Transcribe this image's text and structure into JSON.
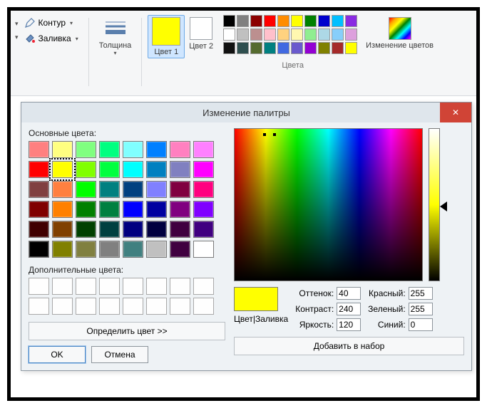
{
  "ribbon": {
    "outline": "Контур",
    "fill": "Заливка",
    "thickness": "Толщина",
    "color1": "Цвет 1",
    "color2": "Цвет 2",
    "color1_value": "#ffff00",
    "color2_value": "#ffffff",
    "palette_row1": [
      "#000000",
      "#808080",
      "#8b0000",
      "#ff0000",
      "#ff8c00",
      "#ffff00",
      "#008000",
      "#0000cd",
      "#00bfff",
      "#8a2be2"
    ],
    "palette_row2": [
      "#ffffff",
      "#c0c0c0",
      "#bc8f8f",
      "#ffc0cb",
      "#ffd27f",
      "#fff8b0",
      "#90ee90",
      "#add8e6",
      "#87cefa",
      "#dda0dd"
    ],
    "palette_row3": [
      "#111111",
      "#2f4f4f",
      "#556b2f",
      "#008080",
      "#4169e1",
      "#6a5acd",
      "#9400d3",
      "#808000",
      "#a52a2a",
      "#ffff00"
    ],
    "edit_colors": "Изменение цветов",
    "group_label": "Цвета"
  },
  "dialog": {
    "title": "Изменение палитры",
    "basic_label": "Основные цвета:",
    "custom_label": "Дополнительные цвета:",
    "basic_rows": [
      [
        "#ff8080",
        "#ffff80",
        "#80ff80",
        "#00ff80",
        "#80ffff",
        "#0080ff",
        "#ff80c0",
        "#ff80ff"
      ],
      [
        "#ff0000",
        "#ffff00",
        "#80ff00",
        "#00ff40",
        "#00ffff",
        "#0080c0",
        "#8080c0",
        "#ff00ff"
      ],
      [
        "#804040",
        "#ff8040",
        "#00ff00",
        "#008080",
        "#004080",
        "#8080ff",
        "#800040",
        "#ff0080"
      ],
      [
        "#800000",
        "#ff8000",
        "#008000",
        "#008040",
        "#0000ff",
        "#0000a0",
        "#800080",
        "#8000ff"
      ],
      [
        "#400000",
        "#804000",
        "#004000",
        "#004040",
        "#000080",
        "#000040",
        "#400040",
        "#400080"
      ],
      [
        "#000000",
        "#808000",
        "#808040",
        "#808080",
        "#408080",
        "#c0c0c0",
        "#400040",
        "#ffffff"
      ]
    ],
    "define_color": "Определить цвет >>",
    "ok": "OK",
    "cancel": "Отмена",
    "preview_label": "Цвет|Заливка",
    "preview_value": "#ffff00",
    "hsv": {
      "hue_lbl": "Оттенок:",
      "sat_lbl": "Контраст:",
      "lum_lbl": "Яркость:",
      "hue": "40",
      "sat": "240",
      "lum": "120"
    },
    "rgb": {
      "r_lbl": "Красный:",
      "g_lbl": "Зеленый:",
      "b_lbl": "Синий:",
      "r": "255",
      "g": "255",
      "b": "0"
    },
    "add": "Добавить в набор",
    "selected_basic": [
      1,
      1
    ]
  }
}
